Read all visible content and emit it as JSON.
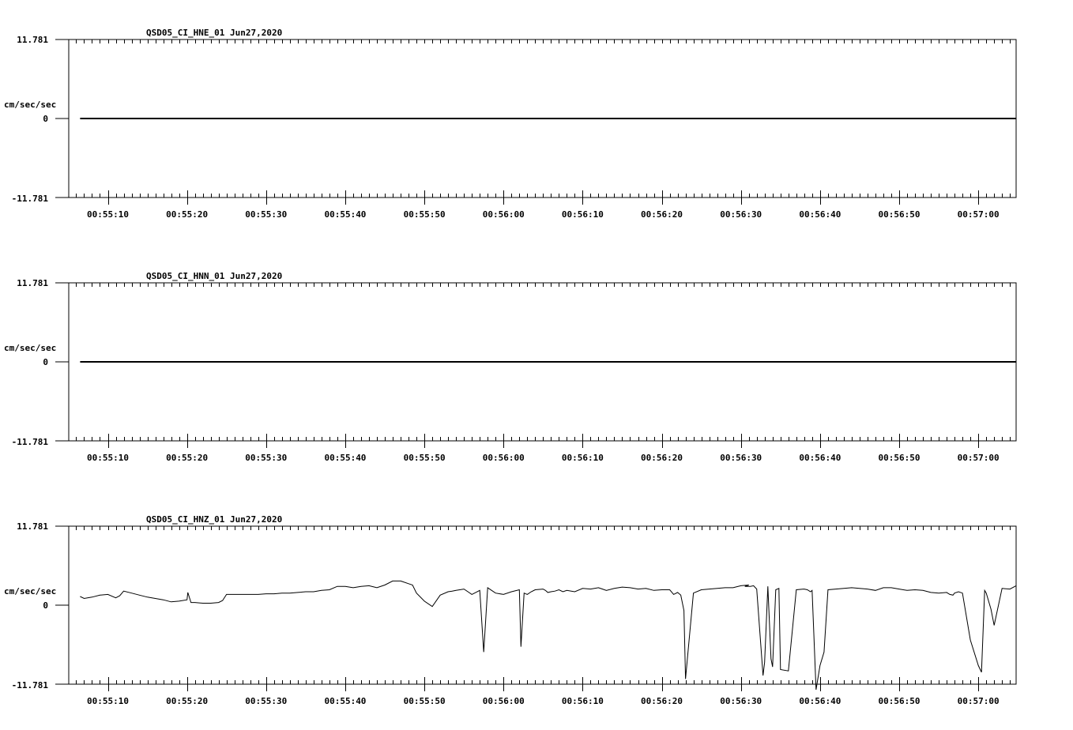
{
  "chart_data": [
    {
      "type": "line",
      "title": "QSD05_CI_HNE_01  Jun27,2020",
      "ylabel": "cm/sec/sec",
      "ylim": [
        -11.781,
        11.781
      ],
      "ytick_labels": [
        "11.781",
        "0",
        "-11.781"
      ],
      "x_ticks": [
        "00:55:10",
        "00:55:20",
        "00:55:30",
        "00:55:40",
        "00:55:50",
        "00:56:00",
        "00:56:10",
        "00:56:20",
        "00:56:30",
        "00:56:40",
        "00:56:50",
        "00:57:00"
      ],
      "series": [
        {
          "t": [
            -3.5,
            115
          ],
          "values": [
            0,
            0
          ]
        }
      ]
    },
    {
      "type": "line",
      "title": "QSD05_CI_HNN_01  Jun27,2020",
      "ylabel": "cm/sec/sec",
      "ylim": [
        -11.781,
        11.781
      ],
      "ytick_labels": [
        "11.781",
        "0",
        "-11.781"
      ],
      "x_ticks": [
        "00:55:10",
        "00:55:20",
        "00:55:30",
        "00:55:40",
        "00:55:50",
        "00:56:00",
        "00:56:10",
        "00:56:20",
        "00:56:30",
        "00:56:40",
        "00:56:50",
        "00:57:00"
      ],
      "series": [
        {
          "t": [
            -3.5,
            115
          ],
          "values": [
            0,
            0
          ]
        }
      ]
    },
    {
      "type": "line",
      "title": "QSD05_CI_HNZ_01  Jun27,2020",
      "ylabel": "cm/sec/sec",
      "ylim": [
        -11.781,
        11.781
      ],
      "ytick_labels": [
        "11.781",
        "0",
        "-11.781"
      ],
      "x_ticks": [
        "00:55:10",
        "00:55:20",
        "00:55:30",
        "00:55:40",
        "00:55:50",
        "00:56:00",
        "00:56:10",
        "00:56:20",
        "00:56:30",
        "00:56:40",
        "00:56:50",
        "00:57:00"
      ],
      "series": [
        {
          "t": [
            -3.5,
            -3,
            -2,
            -1,
            0,
            1,
            1.5,
            2,
            3,
            4,
            5,
            6,
            7,
            8,
            9,
            10,
            10.1,
            10.5,
            11,
            12,
            13,
            14,
            14.5,
            15,
            16,
            17,
            18,
            19,
            20,
            21,
            22,
            23,
            24,
            25,
            26,
            27,
            28,
            29,
            30,
            31,
            32,
            33,
            34,
            35,
            36,
            37,
            38,
            38.5,
            39,
            40,
            41,
            42,
            43,
            43.5,
            44,
            45,
            45.5,
            46,
            47,
            47.5,
            48,
            49,
            50,
            51,
            52,
            52.2,
            52.6,
            53,
            53.5,
            54,
            55,
            55.3,
            55.6,
            56,
            56.5,
            57,
            57.5,
            58,
            59,
            60,
            61,
            62,
            63,
            64,
            65,
            66,
            67,
            68,
            69,
            70,
            71,
            71.5,
            72,
            72.4,
            72.8,
            73,
            74,
            75,
            76,
            77,
            78,
            79,
            80,
            81,
            80.5,
            81.2,
            81.6,
            82,
            82.8,
            83,
            83.4,
            83.8,
            84,
            84.4,
            84.8,
            85,
            86,
            87,
            88,
            88.4,
            88.8,
            89,
            89.5,
            90,
            90.5,
            91,
            92,
            93,
            94,
            95,
            96,
            97,
            98,
            99,
            100,
            101,
            102,
            103,
            104,
            105,
            106,
            106.4,
            106.8,
            107,
            107.5,
            108,
            109,
            110,
            110.4,
            110.8,
            111,
            111.6,
            112,
            113,
            114,
            115
          ],
          "values": [
            1.3,
            1.0,
            1.2,
            1.5,
            1.6,
            1.1,
            1.4,
            2.1,
            1.8,
            1.5,
            1.2,
            1.0,
            0.8,
            0.5,
            0.6,
            0.8,
            1.9,
            0.4,
            0.4,
            0.3,
            0.3,
            0.4,
            0.7,
            1.6,
            1.6,
            1.6,
            1.6,
            1.6,
            1.7,
            1.7,
            1.8,
            1.8,
            1.9,
            2.0,
            2.0,
            2.2,
            2.3,
            2.8,
            2.8,
            2.6,
            2.8,
            2.9,
            2.6,
            3.0,
            3.6,
            3.6,
            3.2,
            3.0,
            1.8,
            0.6,
            -0.2,
            1.5,
            2.0,
            2.1,
            2.2,
            2.4,
            2.0,
            1.6,
            2.2,
            -7.0,
            2.6,
            1.8,
            1.6,
            2.0,
            2.3,
            -6.2,
            1.8,
            1.6,
            2.0,
            2.3,
            2.4,
            2.2,
            1.9,
            2.0,
            2.1,
            2.3,
            2.0,
            2.2,
            2.0,
            2.5,
            2.4,
            2.6,
            2.2,
            2.5,
            2.7,
            2.6,
            2.4,
            2.5,
            2.2,
            2.3,
            2.3,
            1.6,
            1.9,
            1.5,
            -0.8,
            -11.0,
            1.8,
            2.3,
            2.4,
            2.5,
            2.6,
            2.6,
            2.9,
            3.0,
            2.8,
            2.8,
            2.9,
            2.4,
            -10.5,
            -8.5,
            2.8,
            -8.0,
            -9.2,
            2.3,
            2.5,
            -9.6,
            -9.8,
            2.3,
            2.4,
            2.3,
            2.0,
            2.2,
            -12.6,
            -9.0,
            -7.0,
            2.3,
            2.4,
            2.5,
            2.6,
            2.5,
            2.4,
            2.2,
            2.6,
            2.6,
            2.4,
            2.2,
            2.3,
            2.2,
            1.9,
            1.8,
            1.9,
            1.6,
            1.5,
            1.8,
            2.0,
            1.8,
            -5.2,
            -9.0,
            -10.0,
            2.2,
            1.8,
            -0.6,
            -3.0,
            2.5,
            2.4,
            2.9,
            2.7,
            -9.8,
            -7.0,
            -9.9,
            2.1,
            2.0,
            2.2,
            2.0
          ]
        }
      ]
    }
  ]
}
